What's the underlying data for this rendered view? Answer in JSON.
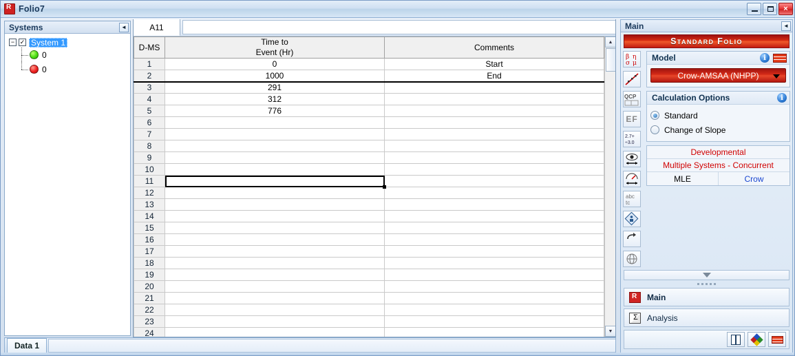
{
  "window": {
    "title": "Folio7",
    "icon": "app-icon",
    "minimize_label": "Minimize",
    "maximize_label": "Maximize",
    "close_label": "×"
  },
  "systems_panel": {
    "header": "Systems",
    "collapse_glyph": "◄",
    "tree": {
      "expander": "−",
      "checkbox": "✓",
      "root_label": "System 1",
      "children": [
        {
          "marker": "green",
          "label": "0"
        },
        {
          "marker": "red",
          "label": "0"
        }
      ]
    }
  },
  "sheet": {
    "name_box": "A11",
    "formula_value": "",
    "formula_placeholder": "",
    "columns": [
      "D-MS",
      "Time to\nEvent (Hr)",
      "Comments"
    ],
    "col_dms": "D-MS",
    "col_time_l1": "Time to",
    "col_time_l2": "Event (Hr)",
    "col_comments": "Comments",
    "rows": [
      {
        "n": "1",
        "time": "0",
        "comment": "Start"
      },
      {
        "n": "2",
        "time": "1000",
        "comment": "End"
      },
      {
        "n": "3",
        "time": "291",
        "comment": ""
      },
      {
        "n": "4",
        "time": "312",
        "comment": ""
      },
      {
        "n": "5",
        "time": "776",
        "comment": ""
      },
      {
        "n": "6",
        "time": "",
        "comment": ""
      },
      {
        "n": "7",
        "time": "",
        "comment": ""
      },
      {
        "n": "8",
        "time": "",
        "comment": ""
      },
      {
        "n": "9",
        "time": "",
        "comment": ""
      },
      {
        "n": "10",
        "time": "",
        "comment": ""
      },
      {
        "n": "11",
        "time": "",
        "comment": ""
      },
      {
        "n": "12",
        "time": "",
        "comment": ""
      },
      {
        "n": "13",
        "time": "",
        "comment": ""
      },
      {
        "n": "14",
        "time": "",
        "comment": ""
      },
      {
        "n": "15",
        "time": "",
        "comment": ""
      },
      {
        "n": "16",
        "time": "",
        "comment": ""
      },
      {
        "n": "17",
        "time": "",
        "comment": ""
      },
      {
        "n": "18",
        "time": "",
        "comment": ""
      },
      {
        "n": "19",
        "time": "",
        "comment": ""
      },
      {
        "n": "20",
        "time": "",
        "comment": ""
      },
      {
        "n": "21",
        "time": "",
        "comment": ""
      },
      {
        "n": "22",
        "time": "",
        "comment": ""
      },
      {
        "n": "23",
        "time": "",
        "comment": ""
      },
      {
        "n": "24",
        "time": "",
        "comment": ""
      }
    ],
    "selected_row_index": 10,
    "separator_after_row_index": 1,
    "scroll_up_glyph": "▲",
    "scroll_down_glyph": "▼"
  },
  "tabstrip": {
    "active_tab": "Data 1"
  },
  "right_panel": {
    "header": "Main",
    "collapse_glyph": "◄",
    "banner": "Standard Folio",
    "toolbar_icons": [
      {
        "name": "parameters-icon",
        "glyph": "β η\nσ μ"
      },
      {
        "name": "scatter-plot-icon",
        "glyph": ""
      },
      {
        "name": "qcp-icon",
        "glyph": "QCP"
      },
      {
        "name": "ef-icon",
        "glyph": "EF"
      },
      {
        "name": "numeric-convert-icon",
        "glyph": "2.7+\n÷3.0"
      },
      {
        "name": "view-range-icon",
        "glyph": ""
      },
      {
        "name": "gauge-icon",
        "glyph": ""
      },
      {
        "name": "abc-text-icon",
        "glyph": "abc"
      },
      {
        "name": "publish-icon",
        "glyph": ""
      },
      {
        "name": "undo-icon",
        "glyph": ""
      },
      {
        "name": "globe-icon",
        "glyph": ""
      }
    ],
    "model": {
      "title": "Model",
      "info_label": "i",
      "selected": "Crow-AMSAA (NHPP)"
    },
    "calculation_options": {
      "title": "Calculation Options",
      "info_label": "i",
      "options": [
        {
          "label": "Standard",
          "selected": true
        },
        {
          "label": "Change of Slope",
          "selected": false
        }
      ]
    },
    "status": {
      "line1": "Developmental",
      "line2": "Multiple Systems - Concurrent",
      "method": "MLE",
      "model_short": "Crow"
    },
    "nav": {
      "main": "Main",
      "analysis": "Analysis"
    },
    "bottom_buttons": [
      {
        "name": "sheet-view-button"
      },
      {
        "name": "plot-view-button"
      },
      {
        "name": "red-bars-button"
      }
    ]
  },
  "colors": {
    "accent_red": "#d32a17",
    "selection_blue": "#3399ff",
    "status_red": "#d00000",
    "status_blue": "#1a46d0"
  }
}
